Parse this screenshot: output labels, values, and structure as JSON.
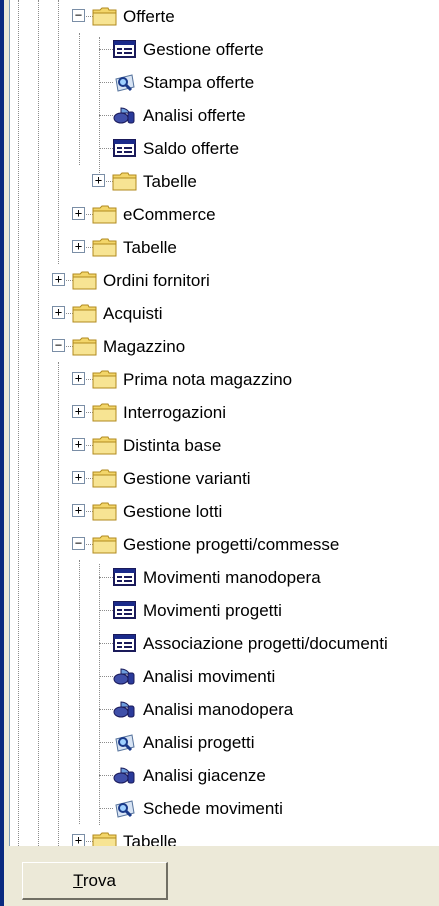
{
  "tree": {
    "items": [
      {
        "label": "Offerte",
        "icon": "folder-icon",
        "expander": "−"
      },
      {
        "label": "Gestione offerte",
        "icon": "form-icon"
      },
      {
        "label": "Stampa offerte",
        "icon": "print-preview-icon"
      },
      {
        "label": "Analisi offerte",
        "icon": "analysis-icon"
      },
      {
        "label": "Saldo offerte",
        "icon": "form-icon"
      },
      {
        "label": "Tabelle",
        "icon": "folder-icon",
        "expander": "+"
      },
      {
        "label": "eCommerce",
        "icon": "folder-icon",
        "expander": "+"
      },
      {
        "label": "Tabelle",
        "icon": "folder-icon",
        "expander": "+"
      },
      {
        "label": "Ordini fornitori",
        "icon": "folder-icon",
        "expander": "+"
      },
      {
        "label": "Acquisti",
        "icon": "folder-icon",
        "expander": "+"
      },
      {
        "label": "Magazzino",
        "icon": "folder-icon",
        "expander": "−"
      },
      {
        "label": "Prima nota magazzino",
        "icon": "folder-icon",
        "expander": "+"
      },
      {
        "label": "Interrogazioni",
        "icon": "folder-icon",
        "expander": "+"
      },
      {
        "label": "Distinta base",
        "icon": "folder-icon",
        "expander": "+"
      },
      {
        "label": "Gestione varianti",
        "icon": "folder-icon",
        "expander": "+"
      },
      {
        "label": "Gestione lotti",
        "icon": "folder-icon",
        "expander": "+"
      },
      {
        "label": "Gestione progetti/commesse",
        "icon": "folder-icon",
        "expander": "−"
      },
      {
        "label": "Movimenti manodopera",
        "icon": "form-icon"
      },
      {
        "label": "Movimenti progetti",
        "icon": "form-icon"
      },
      {
        "label": "Associazione progetti/documenti",
        "icon": "form-icon"
      },
      {
        "label": "Analisi movimenti",
        "icon": "analysis-icon"
      },
      {
        "label": "Analisi manodopera",
        "icon": "analysis-icon"
      },
      {
        "label": "Analisi progetti",
        "icon": "print-preview-icon"
      },
      {
        "label": "Analisi giacenze",
        "icon": "analysis-icon"
      },
      {
        "label": "Schede movimenti",
        "icon": "print-preview-icon"
      },
      {
        "label": "Tabelle",
        "icon": "folder-icon",
        "expander": "+"
      }
    ]
  },
  "footer": {
    "find_button": {
      "accesskey": "T",
      "label_rest": "rova"
    }
  },
  "colors": {
    "window_frame": "#0a2a80",
    "panel": "#ece9d8",
    "tree_background": "#ffffff",
    "folder": "#f3d66a"
  }
}
